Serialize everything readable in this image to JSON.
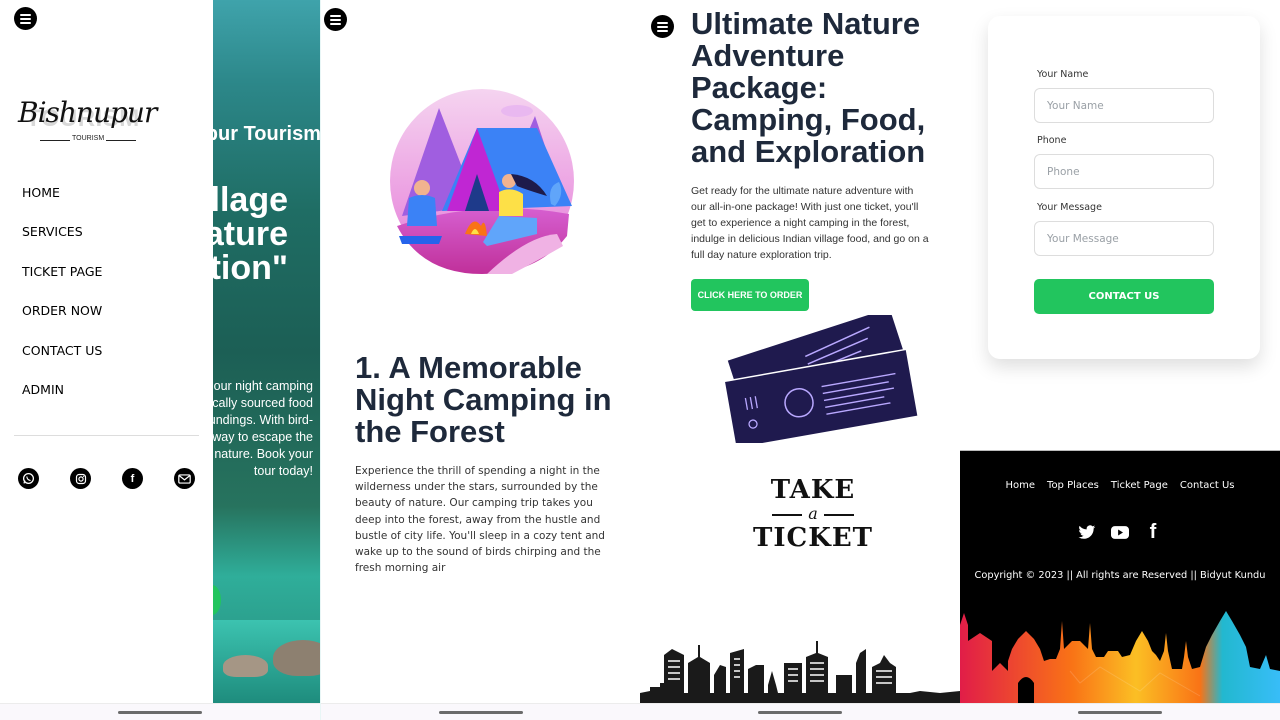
{
  "screen1": {
    "brand": {
      "script": "Bishnupur",
      "background_word": "TOURISM",
      "tagline": "TOURISM"
    },
    "menu": [
      {
        "label": "HOME"
      },
      {
        "label": "SERVICES"
      },
      {
        "label": "TICKET PAGE"
      },
      {
        "label": "ORDER NOW"
      },
      {
        "label": "CONTACT US"
      },
      {
        "label": "ADMIN"
      }
    ],
    "social_icons": [
      "whatsapp-icon",
      "instagram-icon",
      "facebook-icon",
      "mail-icon"
    ],
    "hero": {
      "subtitle": "Bishnupur Tourism",
      "title": "\"Authentic Village Camping Nature Exploration\"",
      "paragraph": "Experience an authentic village with our night camping and enjoy delicious home-cooked locally sourced food and days exploring the surroundings. With bird-watching, and more it's the perfect way to escape the hustle of city life and the beauty of nature. Book your tour today!"
    }
  },
  "screen2": {
    "title": "1. A Memorable Night Camping in the Forest",
    "paragraph": "Experience the thrill of spending a night in the wilderness under the stars, surrounded by the beauty of nature. Our camping trip takes you deep into the forest, away from the hustle and bustle of city life. You'll sleep in a cozy tent and wake up to the sound of birds chirping and the fresh morning air"
  },
  "screen3": {
    "title": "Ultimate Nature Adventure Package: Camping, Food, and Exploration",
    "paragraph": "Get ready for the ultimate nature adventure with our all-in-one package! With just one ticket, you'll get to experience a night camping in the forest, indulge in delicious Indian village food, and go on a full day nature exploration trip.",
    "order_button": "CLICK HERE TO ORDER",
    "logo": {
      "line1": "TAKE",
      "line2": "a",
      "line3": "TICKET"
    }
  },
  "screen4": {
    "form": {
      "name_label": "Your Name",
      "name_placeholder": "Your Name",
      "phone_label": "Phone",
      "phone_placeholder": "Phone",
      "message_label": "Your Message",
      "message_placeholder": "Your Message",
      "submit": "CONTACT US"
    },
    "footer": {
      "links": [
        "Home",
        "Top Places",
        "Ticket Page",
        "Contact Us"
      ],
      "social_icons": [
        "twitter-icon",
        "youtube-icon",
        "facebook-icon"
      ],
      "copyright": "Copyright © 2023 || All rights are Reserved || Bidyut Kundu"
    }
  },
  "colors": {
    "accent_green": "#22c55e",
    "heading": "#1e293b",
    "ticket_navy": "#1f1a4e"
  }
}
